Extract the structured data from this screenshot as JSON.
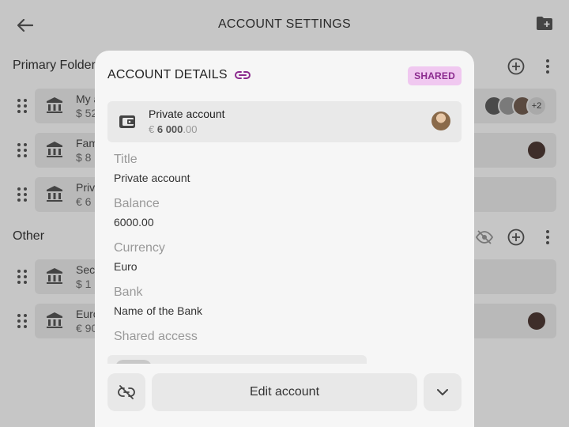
{
  "colors": {
    "backdrop": "#c6c6c6",
    "accent": "#8b2a8e",
    "badge_bg": "#f0c8f0"
  },
  "topbar": {
    "title": "ACCOUNT SETTINGS",
    "back_icon": "arrow-left-icon",
    "folder_add_icon": "folder-plus-icon"
  },
  "sections": {
    "primary": {
      "title": "Primary Folder",
      "rows": [
        {
          "name": "My a",
          "amount": "$ 52",
          "avatars_more": "+2"
        },
        {
          "name": "Fam",
          "amount": "$ 8"
        },
        {
          "name": "Priv",
          "amount": "€ 6"
        }
      ]
    },
    "other": {
      "title": "Other",
      "rows": [
        {
          "name": "Sec",
          "amount": "$ 1"
        },
        {
          "name": "Euro",
          "amount": "€ 90"
        }
      ]
    }
  },
  "modal": {
    "title": "ACCOUNT DETAILS",
    "link_icon": "link-icon",
    "badge": "SHARED",
    "card": {
      "name": "Private account",
      "currency_symbol": "€",
      "amount_whole": "6 000",
      "amount_decimal": ".00",
      "icon": "wallet-icon"
    },
    "fields": {
      "title_label": "Title",
      "title_value": "Private account",
      "balance_label": "Balance",
      "balance_value": "6000.00",
      "currency_label": "Currency",
      "currency_value": "Euro",
      "bank_label": "Bank",
      "bank_value": "Name of the Bank",
      "shared_label": "Shared access"
    },
    "footer": {
      "edit_label": "Edit account",
      "unlink_icon": "unlink-icon",
      "chevron_icon": "chevron-down-icon"
    }
  }
}
